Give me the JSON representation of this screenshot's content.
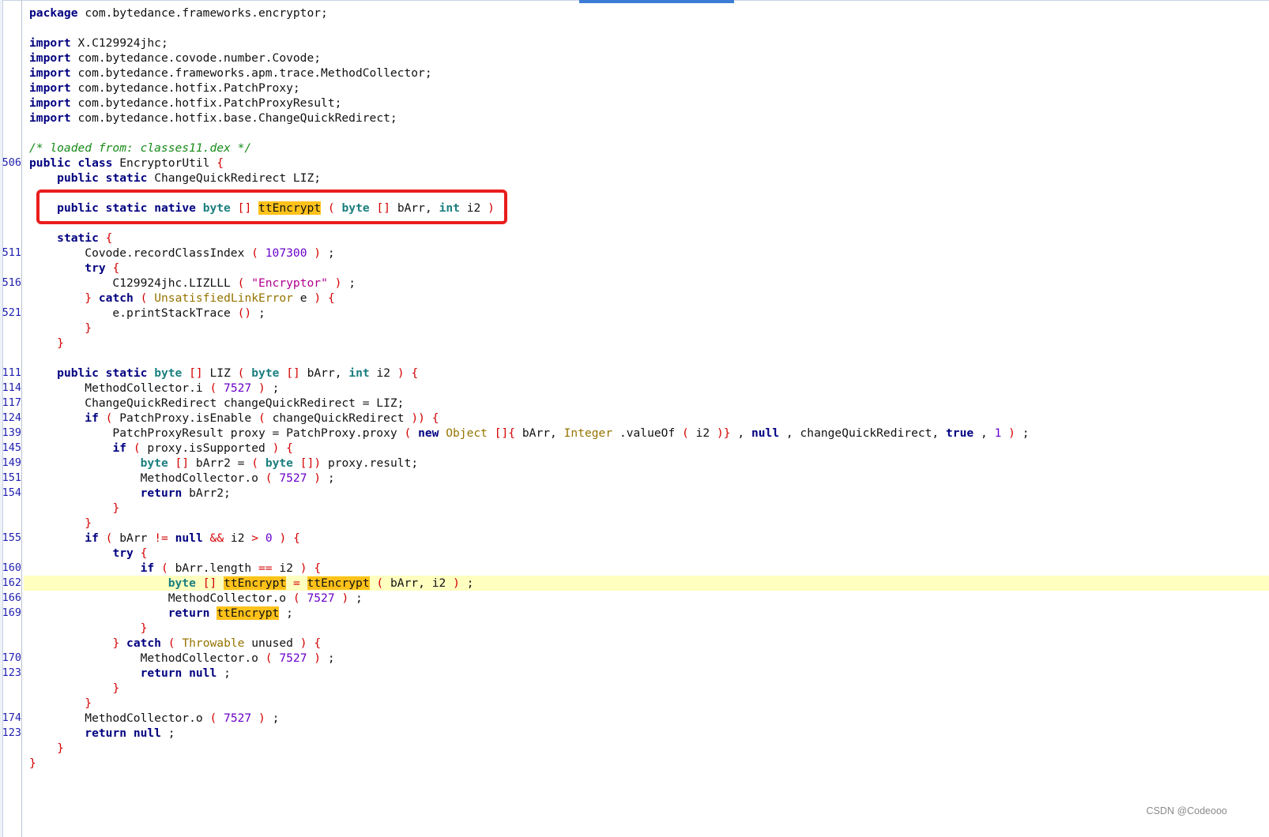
{
  "lines": [
    {
      "ln": "",
      "hl": false,
      "t": [
        [
          "kw",
          "package"
        ],
        [
          "",
          "com.bytedance.frameworks.encryptor;"
        ]
      ]
    },
    {
      "ln": "",
      "hl": false,
      "t": []
    },
    {
      "ln": "",
      "hl": false,
      "t": [
        [
          "kw",
          "import"
        ],
        [
          "",
          "X.C129924jhc;"
        ]
      ]
    },
    {
      "ln": "",
      "hl": false,
      "t": [
        [
          "kw",
          "import"
        ],
        [
          "",
          "com.bytedance.covode.number.Covode;"
        ]
      ]
    },
    {
      "ln": "",
      "hl": false,
      "t": [
        [
          "kw",
          "import"
        ],
        [
          "",
          "com.bytedance.frameworks.apm.trace.MethodCollector;"
        ]
      ]
    },
    {
      "ln": "",
      "hl": false,
      "t": [
        [
          "kw",
          "import"
        ],
        [
          "",
          "com.bytedance.hotfix.PatchProxy;"
        ]
      ]
    },
    {
      "ln": "",
      "hl": false,
      "t": [
        [
          "kw",
          "import"
        ],
        [
          "",
          "com.bytedance.hotfix.PatchProxyResult;"
        ]
      ]
    },
    {
      "ln": "",
      "hl": false,
      "t": [
        [
          "kw",
          "import"
        ],
        [
          "",
          "com.bytedance.hotfix.base.ChangeQuickRedirect;"
        ]
      ]
    },
    {
      "ln": "",
      "hl": false,
      "t": []
    },
    {
      "ln": "",
      "hl": false,
      "t": [
        [
          "cm",
          "/* loaded from: classes11.dex */"
        ]
      ]
    },
    {
      "ln": "506",
      "hl": false,
      "t": [
        [
          "kw",
          "public"
        ],
        [
          "kw",
          "class"
        ],
        [
          "",
          "EncryptorUtil"
        ],
        [
          "br",
          "{"
        ]
      ]
    },
    {
      "ln": "",
      "hl": false,
      "t": [
        [
          "",
          "    "
        ],
        [
          "kw",
          "public"
        ],
        [
          "kw",
          "static"
        ],
        [
          "",
          "ChangeQuickRedirect LIZ;"
        ]
      ]
    },
    {
      "ln": "",
      "hl": false,
      "t": []
    },
    {
      "ln": "",
      "hl": false,
      "t": [
        [
          "",
          "    "
        ],
        [
          "kw",
          "public"
        ],
        [
          "kw",
          "static"
        ],
        [
          "kw",
          "native"
        ],
        [
          "ty",
          "byte"
        ],
        [
          "br",
          "[]"
        ],
        [
          "mk",
          "ttEncrypt"
        ],
        [
          "br",
          "("
        ],
        [
          "ty",
          "byte"
        ],
        [
          "br",
          "[]"
        ],
        [
          "",
          "bArr,"
        ],
        [
          "ty",
          "int"
        ],
        [
          "",
          "i2"
        ],
        [
          "br",
          ")"
        ],
        [
          "",
          ";"
        ]
      ]
    },
    {
      "ln": "",
      "hl": false,
      "t": []
    },
    {
      "ln": "",
      "hl": false,
      "t": [
        [
          "",
          "    "
        ],
        [
          "kw",
          "static"
        ],
        [
          "br",
          "{"
        ]
      ]
    },
    {
      "ln": "511",
      "hl": false,
      "t": [
        [
          "",
          "        Covode.recordClassIndex"
        ],
        [
          "br",
          "("
        ],
        [
          "num",
          "107300"
        ],
        [
          "br",
          ")"
        ],
        [
          "",
          ";"
        ]
      ]
    },
    {
      "ln": "",
      "hl": false,
      "t": [
        [
          "",
          "        "
        ],
        [
          "kw",
          "try"
        ],
        [
          "br",
          "{"
        ]
      ]
    },
    {
      "ln": "516",
      "hl": false,
      "t": [
        [
          "",
          "            C129924jhc.LIZLLL"
        ],
        [
          "br",
          "("
        ],
        [
          "str",
          "\"Encryptor\""
        ],
        [
          "br",
          ")"
        ],
        [
          "",
          ";"
        ]
      ]
    },
    {
      "ln": "",
      "hl": false,
      "t": [
        [
          "",
          "        "
        ],
        [
          "br",
          "}"
        ],
        [
          "kw",
          "catch"
        ],
        [
          "br",
          "("
        ],
        [
          "cls",
          "UnsatisfiedLinkError"
        ],
        [
          "",
          "e"
        ],
        [
          "br",
          ")"
        ],
        [
          "br",
          "{"
        ]
      ]
    },
    {
      "ln": "521",
      "hl": false,
      "t": [
        [
          "",
          "            e.printStackTrace"
        ],
        [
          "br",
          "()"
        ],
        [
          "",
          ";"
        ]
      ]
    },
    {
      "ln": "",
      "hl": false,
      "t": [
        [
          "",
          "        "
        ],
        [
          "br",
          "}"
        ]
      ]
    },
    {
      "ln": "",
      "hl": false,
      "t": [
        [
          "",
          "    "
        ],
        [
          "br",
          "}"
        ]
      ]
    },
    {
      "ln": "",
      "hl": false,
      "t": []
    },
    {
      "ln": "111",
      "hl": false,
      "t": [
        [
          "",
          "    "
        ],
        [
          "kw",
          "public"
        ],
        [
          "kw",
          "static"
        ],
        [
          "ty",
          "byte"
        ],
        [
          "br",
          "[]"
        ],
        [
          "",
          "LIZ"
        ],
        [
          "br",
          "("
        ],
        [
          "ty",
          "byte"
        ],
        [
          "br",
          "[]"
        ],
        [
          "",
          "bArr,"
        ],
        [
          "ty",
          "int"
        ],
        [
          "",
          "i2"
        ],
        [
          "br",
          ")"
        ],
        [
          "br",
          "{"
        ]
      ]
    },
    {
      "ln": "114",
      "hl": false,
      "t": [
        [
          "",
          "        MethodCollector.i"
        ],
        [
          "br",
          "("
        ],
        [
          "num",
          "7527"
        ],
        [
          "br",
          ")"
        ],
        [
          "",
          ";"
        ]
      ]
    },
    {
      "ln": "117",
      "hl": false,
      "t": [
        [
          "",
          "        ChangeQuickRedirect changeQuickRedirect = LIZ;"
        ]
      ]
    },
    {
      "ln": "124",
      "hl": false,
      "t": [
        [
          "",
          "        "
        ],
        [
          "kw",
          "if"
        ],
        [
          "br",
          "("
        ],
        [
          "",
          "PatchProxy.isEnable"
        ],
        [
          "br",
          "("
        ],
        [
          "",
          "changeQuickRedirect"
        ],
        [
          "br",
          "))"
        ],
        [
          "br",
          "{"
        ]
      ]
    },
    {
      "ln": "139",
      "hl": false,
      "t": [
        [
          "",
          "            PatchProxyResult proxy = PatchProxy.proxy"
        ],
        [
          "br",
          "("
        ],
        [
          "kw",
          "new"
        ],
        [
          "cls",
          "Object"
        ],
        [
          "br",
          "[]{"
        ],
        [
          "",
          "bArr,"
        ],
        [
          "cls",
          "Integer"
        ],
        [
          "",
          ".valueOf"
        ],
        [
          "br",
          "("
        ],
        [
          "",
          "i2"
        ],
        [
          "br",
          ")}"
        ],
        [
          "",
          ","
        ],
        [
          "kw",
          "null"
        ],
        [
          "",
          ", changeQuickRedirect,"
        ],
        [
          "kw",
          "true"
        ],
        [
          "",
          ","
        ],
        [
          "num",
          "1"
        ],
        [
          "br",
          ")"
        ],
        [
          "",
          ";"
        ]
      ]
    },
    {
      "ln": "145",
      "hl": false,
      "t": [
        [
          "",
          "            "
        ],
        [
          "kw",
          "if"
        ],
        [
          "br",
          "("
        ],
        [
          "",
          "proxy.isSupported"
        ],
        [
          "br",
          ")"
        ],
        [
          "br",
          "{"
        ]
      ]
    },
    {
      "ln": "149",
      "hl": false,
      "t": [
        [
          "",
          "                "
        ],
        [
          "ty",
          "byte"
        ],
        [
          "br",
          "[]"
        ],
        [
          "",
          "bArr2 ="
        ],
        [
          "br",
          "("
        ],
        [
          "ty",
          "byte"
        ],
        [
          "br",
          "[])"
        ],
        [
          "",
          "proxy.result;"
        ]
      ]
    },
    {
      "ln": "151",
      "hl": false,
      "t": [
        [
          "",
          "                MethodCollector.o"
        ],
        [
          "br",
          "("
        ],
        [
          "num",
          "7527"
        ],
        [
          "br",
          ")"
        ],
        [
          "",
          ";"
        ]
      ]
    },
    {
      "ln": "154",
      "hl": false,
      "t": [
        [
          "",
          "                "
        ],
        [
          "kw",
          "return"
        ],
        [
          "",
          "bArr2;"
        ]
      ]
    },
    {
      "ln": "",
      "hl": false,
      "t": [
        [
          "",
          "            "
        ],
        [
          "br",
          "}"
        ]
      ]
    },
    {
      "ln": "",
      "hl": false,
      "t": [
        [
          "",
          "        "
        ],
        [
          "br",
          "}"
        ]
      ]
    },
    {
      "ln": "155",
      "hl": false,
      "t": [
        [
          "",
          "        "
        ],
        [
          "kw",
          "if"
        ],
        [
          "br",
          "("
        ],
        [
          "",
          "bArr"
        ],
        [
          "br",
          "!="
        ],
        [
          "kw",
          "null"
        ],
        [
          "br",
          "&&"
        ],
        [
          "",
          "i2"
        ],
        [
          "br",
          ">"
        ],
        [
          "num",
          "0"
        ],
        [
          "br",
          ")"
        ],
        [
          "br",
          "{"
        ]
      ]
    },
    {
      "ln": "",
      "hl": false,
      "t": [
        [
          "",
          "            "
        ],
        [
          "kw",
          "try"
        ],
        [
          "br",
          "{"
        ]
      ]
    },
    {
      "ln": "160",
      "hl": false,
      "t": [
        [
          "",
          "                "
        ],
        [
          "kw",
          "if"
        ],
        [
          "br",
          "("
        ],
        [
          "",
          "bArr.length"
        ],
        [
          "br",
          "=="
        ],
        [
          "",
          "i2"
        ],
        [
          "br",
          ")"
        ],
        [
          "br",
          "{"
        ]
      ]
    },
    {
      "ln": "162",
      "hl": true,
      "t": [
        [
          "",
          "                    "
        ],
        [
          "ty",
          "byte"
        ],
        [
          "br",
          "[]"
        ],
        [
          "mk",
          "ttEncrypt"
        ],
        [
          "br",
          "="
        ],
        [
          "mk",
          "ttEncrypt"
        ],
        [
          "br",
          "("
        ],
        [
          "",
          "bArr, i2"
        ],
        [
          "br",
          ")"
        ],
        [
          "",
          ";"
        ]
      ]
    },
    {
      "ln": "166",
      "hl": false,
      "t": [
        [
          "",
          "                    MethodCollector.o"
        ],
        [
          "br",
          "("
        ],
        [
          "num",
          "7527"
        ],
        [
          "br",
          ")"
        ],
        [
          "",
          ";"
        ]
      ]
    },
    {
      "ln": "169",
      "hl": false,
      "t": [
        [
          "",
          "                    "
        ],
        [
          "kw",
          "return"
        ],
        [
          "mk",
          "ttEncrypt"
        ],
        [
          "",
          ";"
        ]
      ]
    },
    {
      "ln": "",
      "hl": false,
      "t": [
        [
          "",
          "                "
        ],
        [
          "br",
          "}"
        ]
      ]
    },
    {
      "ln": "",
      "hl": false,
      "t": [
        [
          "",
          "            "
        ],
        [
          "br",
          "}"
        ],
        [
          "kw",
          "catch"
        ],
        [
          "br",
          "("
        ],
        [
          "cls",
          "Throwable"
        ],
        [
          "",
          "unused"
        ],
        [
          "br",
          ")"
        ],
        [
          "br",
          "{"
        ]
      ]
    },
    {
      "ln": "170",
      "hl": false,
      "t": [
        [
          "",
          "                MethodCollector.o"
        ],
        [
          "br",
          "("
        ],
        [
          "num",
          "7527"
        ],
        [
          "br",
          ")"
        ],
        [
          "",
          ";"
        ]
      ]
    },
    {
      "ln": "123",
      "hl": false,
      "t": [
        [
          "",
          "                "
        ],
        [
          "kw",
          "return"
        ],
        [
          "kw",
          "null"
        ],
        [
          "",
          ";"
        ]
      ]
    },
    {
      "ln": "",
      "hl": false,
      "t": [
        [
          "",
          "            "
        ],
        [
          "br",
          "}"
        ]
      ]
    },
    {
      "ln": "",
      "hl": false,
      "t": [
        [
          "",
          "        "
        ],
        [
          "br",
          "}"
        ]
      ]
    },
    {
      "ln": "174",
      "hl": false,
      "t": [
        [
          "",
          "        MethodCollector.o"
        ],
        [
          "br",
          "("
        ],
        [
          "num",
          "7527"
        ],
        [
          "br",
          ")"
        ],
        [
          "",
          ";"
        ]
      ]
    },
    {
      "ln": "123",
      "hl": false,
      "t": [
        [
          "",
          "        "
        ],
        [
          "kw",
          "return"
        ],
        [
          "kw",
          "null"
        ],
        [
          "",
          ";"
        ]
      ]
    },
    {
      "ln": "",
      "hl": false,
      "t": [
        [
          "",
          "    "
        ],
        [
          "br",
          "}"
        ]
      ]
    },
    {
      "ln": "",
      "hl": false,
      "t": [
        [
          "br",
          "}"
        ]
      ]
    }
  ],
  "watermark": "CSDN @Codeooo"
}
